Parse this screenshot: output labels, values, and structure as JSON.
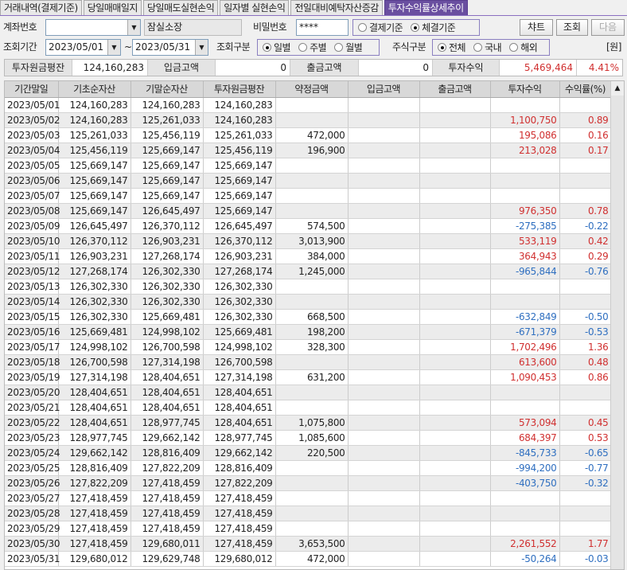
{
  "tabs": [
    "거래내역(결제기준)",
    "당일매매일지",
    "당일매도실현손익",
    "일자별 실현손익",
    "전일대비예탁자산증감",
    "투자수익률상세추이"
  ],
  "active_tab": 5,
  "form": {
    "account_label": "계좌번호",
    "account_value": "",
    "branch": "잠실소장",
    "password_label": "비밀번호",
    "password_value": "****",
    "basis_options": [
      "결제기준",
      "체결기준"
    ],
    "basis_selected": 1,
    "chart_button": "챠트",
    "query_button": "조회",
    "next_button": "다음",
    "period_label": "조회기간",
    "date_from": "2023/05/01",
    "tilde": "~",
    "date_to": "2023/05/31",
    "query_type_label": "조회구분",
    "query_type_options": [
      "일별",
      "주별",
      "월별"
    ],
    "query_type_selected": 0,
    "stock_type_label": "주식구분",
    "stock_type_options": [
      "전체",
      "국내",
      "해외"
    ],
    "stock_type_selected": 0,
    "unit": "[원]"
  },
  "summary": {
    "principal_label": "투자원금평잔",
    "principal_value": "124,160,283",
    "deposit_label": "입금고액",
    "deposit_value": "0",
    "withdraw_label": "출금고액",
    "withdraw_value": "0",
    "profit_label": "투자수익",
    "profit_value": "5,469,464",
    "profit_rate": "4.41%"
  },
  "table": {
    "columns": [
      "기간말일",
      "기초순자산",
      "기말순자산",
      "투자원금평잔",
      "약정금액",
      "입금고액",
      "출금고액",
      "투자수익",
      "수익률(%)"
    ],
    "rows": [
      [
        "2023/05/01",
        "124,160,283",
        "124,160,283",
        "124,160,283",
        "",
        "",
        "",
        "",
        ""
      ],
      [
        "2023/05/02",
        "124,160,283",
        "125,261,033",
        "124,160,283",
        "",
        "",
        "",
        "1,100,750",
        "0.89"
      ],
      [
        "2023/05/03",
        "125,261,033",
        "125,456,119",
        "125,261,033",
        "472,000",
        "",
        "",
        "195,086",
        "0.16"
      ],
      [
        "2023/05/04",
        "125,456,119",
        "125,669,147",
        "125,456,119",
        "196,900",
        "",
        "",
        "213,028",
        "0.17"
      ],
      [
        "2023/05/05",
        "125,669,147",
        "125,669,147",
        "125,669,147",
        "",
        "",
        "",
        "",
        ""
      ],
      [
        "2023/05/06",
        "125,669,147",
        "125,669,147",
        "125,669,147",
        "",
        "",
        "",
        "",
        ""
      ],
      [
        "2023/05/07",
        "125,669,147",
        "125,669,147",
        "125,669,147",
        "",
        "",
        "",
        "",
        ""
      ],
      [
        "2023/05/08",
        "125,669,147",
        "126,645,497",
        "125,669,147",
        "",
        "",
        "",
        "976,350",
        "0.78"
      ],
      [
        "2023/05/09",
        "126,645,497",
        "126,370,112",
        "126,645,497",
        "574,500",
        "",
        "",
        "-275,385",
        "-0.22"
      ],
      [
        "2023/05/10",
        "126,370,112",
        "126,903,231",
        "126,370,112",
        "3,013,900",
        "",
        "",
        "533,119",
        "0.42"
      ],
      [
        "2023/05/11",
        "126,903,231",
        "127,268,174",
        "126,903,231",
        "384,000",
        "",
        "",
        "364,943",
        "0.29"
      ],
      [
        "2023/05/12",
        "127,268,174",
        "126,302,330",
        "127,268,174",
        "1,245,000",
        "",
        "",
        "-965,844",
        "-0.76"
      ],
      [
        "2023/05/13",
        "126,302,330",
        "126,302,330",
        "126,302,330",
        "",
        "",
        "",
        "",
        ""
      ],
      [
        "2023/05/14",
        "126,302,330",
        "126,302,330",
        "126,302,330",
        "",
        "",
        "",
        "",
        ""
      ],
      [
        "2023/05/15",
        "126,302,330",
        "125,669,481",
        "126,302,330",
        "668,500",
        "",
        "",
        "-632,849",
        "-0.50"
      ],
      [
        "2023/05/16",
        "125,669,481",
        "124,998,102",
        "125,669,481",
        "198,200",
        "",
        "",
        "-671,379",
        "-0.53"
      ],
      [
        "2023/05/17",
        "124,998,102",
        "126,700,598",
        "124,998,102",
        "328,300",
        "",
        "",
        "1,702,496",
        "1.36"
      ],
      [
        "2023/05/18",
        "126,700,598",
        "127,314,198",
        "126,700,598",
        "",
        "",
        "",
        "613,600",
        "0.48"
      ],
      [
        "2023/05/19",
        "127,314,198",
        "128,404,651",
        "127,314,198",
        "631,200",
        "",
        "",
        "1,090,453",
        "0.86"
      ],
      [
        "2023/05/20",
        "128,404,651",
        "128,404,651",
        "128,404,651",
        "",
        "",
        "",
        "",
        ""
      ],
      [
        "2023/05/21",
        "128,404,651",
        "128,404,651",
        "128,404,651",
        "",
        "",
        "",
        "",
        ""
      ],
      [
        "2023/05/22",
        "128,404,651",
        "128,977,745",
        "128,404,651",
        "1,075,800",
        "",
        "",
        "573,094",
        "0.45"
      ],
      [
        "2023/05/23",
        "128,977,745",
        "129,662,142",
        "128,977,745",
        "1,085,600",
        "",
        "",
        "684,397",
        "0.53"
      ],
      [
        "2023/05/24",
        "129,662,142",
        "128,816,409",
        "129,662,142",
        "220,500",
        "",
        "",
        "-845,733",
        "-0.65"
      ],
      [
        "2023/05/25",
        "128,816,409",
        "127,822,209",
        "128,816,409",
        "",
        "",
        "",
        "-994,200",
        "-0.77"
      ],
      [
        "2023/05/26",
        "127,822,209",
        "127,418,459",
        "127,822,209",
        "",
        "",
        "",
        "-403,750",
        "-0.32"
      ],
      [
        "2023/05/27",
        "127,418,459",
        "127,418,459",
        "127,418,459",
        "",
        "",
        "",
        "",
        ""
      ],
      [
        "2023/05/28",
        "127,418,459",
        "127,418,459",
        "127,418,459",
        "",
        "",
        "",
        "",
        ""
      ],
      [
        "2023/05/29",
        "127,418,459",
        "127,418,459",
        "127,418,459",
        "",
        "",
        "",
        "",
        ""
      ],
      [
        "2023/05/30",
        "127,418,459",
        "129,680,011",
        "127,418,459",
        "3,653,500",
        "",
        "",
        "2,261,552",
        "1.77"
      ],
      [
        "2023/05/31",
        "129,680,012",
        "129,629,748",
        "129,680,012",
        "472,000",
        "",
        "",
        "-50,264",
        "-0.03"
      ]
    ]
  },
  "colors": {
    "positive": "#d03030",
    "negative": "#2f6fc0",
    "active_tab": "#6a4fa0"
  }
}
